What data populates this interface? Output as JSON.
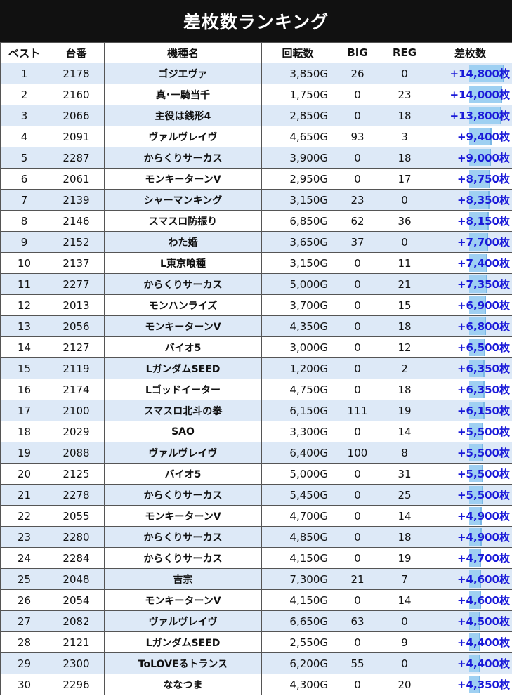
{
  "title": "差枚数ランキング",
  "columns": [
    "ベスト",
    "台番",
    "機種名",
    "回転数",
    "BIG",
    "REG",
    "差枚数"
  ],
  "colors": {
    "header_bg": "#111111",
    "row_alt": "#dde9f7",
    "diff_text": "#1a1ad8",
    "bar": "#9fd0f2"
  },
  "rows": [
    {
      "rank": "1",
      "machine_no": "2178",
      "name": "ゴジエヴァ",
      "spins": "3,850G",
      "big": "26",
      "reg": "0",
      "diff": "+14,800枚",
      "diff_value": 14800
    },
    {
      "rank": "2",
      "machine_no": "2160",
      "name": "真･一騎当千",
      "spins": "1,750G",
      "big": "0",
      "reg": "23",
      "diff": "+14,000枚",
      "diff_value": 14000
    },
    {
      "rank": "3",
      "machine_no": "2066",
      "name": "主役は銭形4",
      "spins": "2,850G",
      "big": "0",
      "reg": "18",
      "diff": "+13,800枚",
      "diff_value": 13800
    },
    {
      "rank": "4",
      "machine_no": "2091",
      "name": "ヴァルヴレイヴ",
      "spins": "4,650G",
      "big": "93",
      "reg": "3",
      "diff": "+9,400枚",
      "diff_value": 9400
    },
    {
      "rank": "5",
      "machine_no": "2287",
      "name": "からくりサーカス",
      "spins": "3,900G",
      "big": "0",
      "reg": "18",
      "diff": "+9,000枚",
      "diff_value": 9000
    },
    {
      "rank": "6",
      "machine_no": "2061",
      "name": "モンキーターンV",
      "spins": "2,950G",
      "big": "0",
      "reg": "17",
      "diff": "+8,750枚",
      "diff_value": 8750
    },
    {
      "rank": "7",
      "machine_no": "2139",
      "name": "シャーマンキング",
      "spins": "3,150G",
      "big": "23",
      "reg": "0",
      "diff": "+8,350枚",
      "diff_value": 8350
    },
    {
      "rank": "8",
      "machine_no": "2146",
      "name": "スマスロ防振り",
      "spins": "6,850G",
      "big": "62",
      "reg": "36",
      "diff": "+8,150枚",
      "diff_value": 8150
    },
    {
      "rank": "9",
      "machine_no": "2152",
      "name": "わた婚",
      "spins": "3,650G",
      "big": "37",
      "reg": "0",
      "diff": "+7,700枚",
      "diff_value": 7700
    },
    {
      "rank": "10",
      "machine_no": "2137",
      "name": "L東京喰種",
      "spins": "3,150G",
      "big": "0",
      "reg": "11",
      "diff": "+7,400枚",
      "diff_value": 7400
    },
    {
      "rank": "11",
      "machine_no": "2277",
      "name": "からくりサーカス",
      "spins": "5,000G",
      "big": "0",
      "reg": "21",
      "diff": "+7,350枚",
      "diff_value": 7350
    },
    {
      "rank": "12",
      "machine_no": "2013",
      "name": "モンハンライズ",
      "spins": "3,700G",
      "big": "0",
      "reg": "15",
      "diff": "+6,900枚",
      "diff_value": 6900
    },
    {
      "rank": "13",
      "machine_no": "2056",
      "name": "モンキーターンV",
      "spins": "4,350G",
      "big": "0",
      "reg": "18",
      "diff": "+6,800枚",
      "diff_value": 6800
    },
    {
      "rank": "14",
      "machine_no": "2127",
      "name": "バイオ5",
      "spins": "3,000G",
      "big": "0",
      "reg": "12",
      "diff": "+6,500枚",
      "diff_value": 6500
    },
    {
      "rank": "15",
      "machine_no": "2119",
      "name": "LガンダムSEED",
      "spins": "1,200G",
      "big": "0",
      "reg": "2",
      "diff": "+6,350枚",
      "diff_value": 6350
    },
    {
      "rank": "16",
      "machine_no": "2174",
      "name": "Lゴッドイーター",
      "spins": "4,750G",
      "big": "0",
      "reg": "18",
      "diff": "+6,350枚",
      "diff_value": 6350
    },
    {
      "rank": "17",
      "machine_no": "2100",
      "name": "スマスロ北斗の拳",
      "spins": "6,150G",
      "big": "111",
      "reg": "19",
      "diff": "+6,150枚",
      "diff_value": 6150
    },
    {
      "rank": "18",
      "machine_no": "2029",
      "name": "SAO",
      "spins": "3,300G",
      "big": "0",
      "reg": "14",
      "diff": "+5,500枚",
      "diff_value": 5500
    },
    {
      "rank": "19",
      "machine_no": "2088",
      "name": "ヴァルヴレイヴ",
      "spins": "6,400G",
      "big": "100",
      "reg": "8",
      "diff": "+5,500枚",
      "diff_value": 5500
    },
    {
      "rank": "20",
      "machine_no": "2125",
      "name": "バイオ5",
      "spins": "5,000G",
      "big": "0",
      "reg": "31",
      "diff": "+5,500枚",
      "diff_value": 5500
    },
    {
      "rank": "21",
      "machine_no": "2278",
      "name": "からくりサーカス",
      "spins": "5,450G",
      "big": "0",
      "reg": "25",
      "diff": "+5,500枚",
      "diff_value": 5500
    },
    {
      "rank": "22",
      "machine_no": "2055",
      "name": "モンキーターンV",
      "spins": "4,700G",
      "big": "0",
      "reg": "14",
      "diff": "+4,900枚",
      "diff_value": 4900
    },
    {
      "rank": "23",
      "machine_no": "2280",
      "name": "からくりサーカス",
      "spins": "4,850G",
      "big": "0",
      "reg": "18",
      "diff": "+4,900枚",
      "diff_value": 4900
    },
    {
      "rank": "24",
      "machine_no": "2284",
      "name": "からくりサーカス",
      "spins": "4,150G",
      "big": "0",
      "reg": "19",
      "diff": "+4,700枚",
      "diff_value": 4700
    },
    {
      "rank": "25",
      "machine_no": "2048",
      "name": "吉宗",
      "spins": "7,300G",
      "big": "21",
      "reg": "7",
      "diff": "+4,600枚",
      "diff_value": 4600
    },
    {
      "rank": "26",
      "machine_no": "2054",
      "name": "モンキーターンV",
      "spins": "4,150G",
      "big": "0",
      "reg": "14",
      "diff": "+4,600枚",
      "diff_value": 4600
    },
    {
      "rank": "27",
      "machine_no": "2082",
      "name": "ヴァルヴレイヴ",
      "spins": "6,650G",
      "big": "63",
      "reg": "0",
      "diff": "+4,500枚",
      "diff_value": 4500
    },
    {
      "rank": "28",
      "machine_no": "2121",
      "name": "LガンダムSEED",
      "spins": "2,550G",
      "big": "0",
      "reg": "9",
      "diff": "+4,400枚",
      "diff_value": 4400
    },
    {
      "rank": "29",
      "machine_no": "2300",
      "name": "ToLOVEるトランス",
      "spins": "6,200G",
      "big": "55",
      "reg": "0",
      "diff": "+4,400枚",
      "diff_value": 4400
    },
    {
      "rank": "30",
      "machine_no": "2296",
      "name": "ななつま",
      "spins": "4,300G",
      "big": "0",
      "reg": "20",
      "diff": "+4,350枚",
      "diff_value": 4350
    }
  ]
}
